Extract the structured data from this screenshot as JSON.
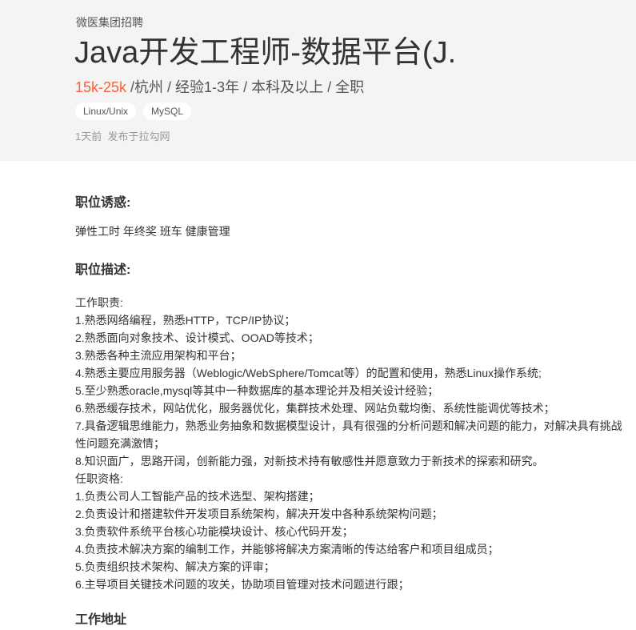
{
  "header": {
    "company": "微医集团招聘",
    "job_title": "Java开发工程师-数据平台(J...",
    "salary": "15k-25k",
    "meta_rest": " /杭州 / 经验1-3年 / 本科及以上 / 全职",
    "tags": [
      "Linux/Unix",
      "MySQL"
    ],
    "publish_time": "1天前",
    "publish_source": "发布于拉勾网"
  },
  "perks_section": {
    "title": "职位诱惑:",
    "text": "弹性工时 年终奖 班车 健康管理"
  },
  "description_section": {
    "title": "职位描述:",
    "lines": [
      "工作职责:",
      "1.熟悉网络编程，熟悉HTTP，TCP/IP协议；",
      "2.熟悉面向对象技术、设计模式、OOAD等技术；",
      "3.熟悉各种主流应用架构和平台；",
      "4.熟悉主要应用服务器（Weblogic/WebSphere/Tomcat等）的配置和使用，熟悉Linux操作系统;",
      "5.至少熟悉oracle,mysql等其中一种数据库的基本理论并及相关设计经验；",
      "6.熟悉缓存技术，网站优化，服务器优化，集群技术处理、网站负载均衡、系统性能调优等技术；",
      "7.具备逻辑思维能力，熟悉业务抽象和数据模型设计，具有很强的分析问题和解决问题的能力，对解决具有挑战性问题充满激情；",
      "8.知识面广，思路开阔，创新能力强，对新技术持有敏感性并愿意致力于新技术的探索和研究。",
      "任职资格:",
      "1.负责公司人工智能产品的技术选型、架构搭建；",
      "2.负责设计和搭建软件开发项目系统架构，解决开发中各种系统架构问题；",
      "3.负责软件系统平台核心功能模块设计、核心代码开发；",
      "4.负责技术解决方案的编制工作，并能够将解决方案清晰的传达给客户和项目组成员；",
      "5.负责组织技术架构、解决方案的评审；",
      "6.主导项目关键技术问题的攻关，协助项目管理对技术问题进行跟；"
    ]
  },
  "address_section": {
    "title": "工作地址"
  }
}
